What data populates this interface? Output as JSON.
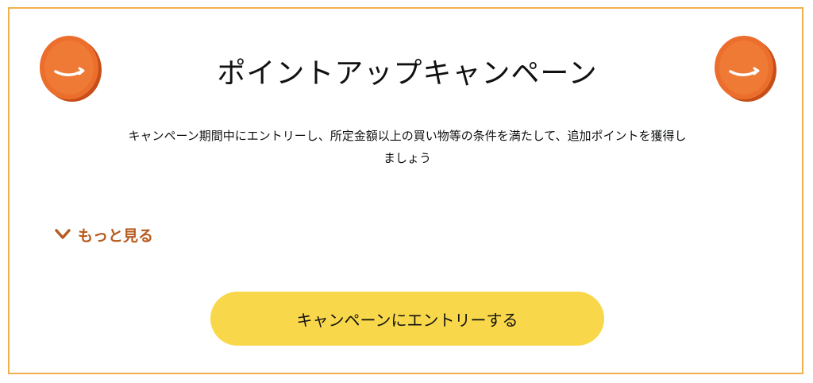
{
  "campaign": {
    "title": "ポイントアップキャンペーン",
    "description": "キャンペーン期間中にエントリーし、所定金額以上の買い物等の条件を満たして、追加ポイントを獲得しましょう",
    "more_label": "もっと見る",
    "entry_button_label": "キャンペーンにエントリーする"
  },
  "icons": {
    "coin_left": "amazon-smile-coin-icon",
    "coin_right": "amazon-smile-coin-icon",
    "more": "chevron-down-icon"
  },
  "colors": {
    "border": "#f0b04b",
    "coin": "#ea6a2a",
    "more_link": "#b85b1e",
    "button": "#f8d84a"
  }
}
